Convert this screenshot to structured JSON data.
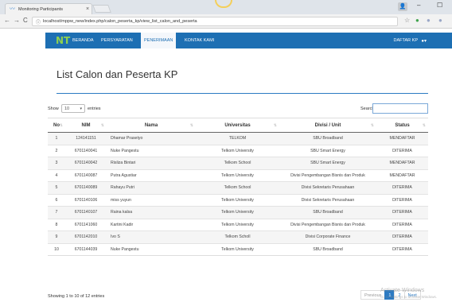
{
  "browser": {
    "tab_title": "Monitoring Participants",
    "tab_close": "×",
    "url": "localhost/mppw_new/index.php/calon_peserta_kp/view_list_calon_and_peserta",
    "back": "←",
    "forward": "→",
    "reload": "C",
    "info": "ⓘ",
    "minimize": "–",
    "maximize": "☐",
    "user_icon": "👤",
    "star": "☆",
    "icons": {
      "back": "arrow-left-icon",
      "forward": "arrow-right-icon",
      "reload": "reload-icon",
      "star": "star-icon"
    }
  },
  "navbar": {
    "brand": "NT",
    "items": [
      "BERANDA",
      "PERSYARATAN",
      "PENERIMAAN",
      "KONTAK KAMI"
    ],
    "active_index": 2,
    "right_label": "DAFTAR KP",
    "user_caret": "▾",
    "colors": {
      "bar": "#1d6fb3",
      "active_bg": "#f4f7fb"
    }
  },
  "page": {
    "title": "List Calon dan Peserta KP"
  },
  "controls": {
    "show_label": "Show",
    "length_value": "10",
    "entries_label": "entries",
    "search_label": "Search:"
  },
  "table": {
    "headers": [
      "No",
      "NIM",
      "Nama",
      "Universitas",
      "Divisi / Unit",
      "Status"
    ],
    "rows": [
      [
        "1",
        "124141151",
        "Dhamar Prasetyo",
        "TELKOM",
        "SBU Broadband",
        "MENDAFTAR"
      ],
      [
        "2",
        "6701140041",
        "Nuke Pangestu",
        "Telkom University",
        "SBU Smart Energy",
        "DITERIMA"
      ],
      [
        "3",
        "6701140042",
        "Risliza Bintari",
        "Telkom School",
        "SBU Smart Energy",
        "MENDAFTAR"
      ],
      [
        "4",
        "6701140087",
        "Putra Agustiar",
        "Telkom University",
        "Divisi Pengembangan Bisnis dan Produk",
        "MENDAFTAR"
      ],
      [
        "5",
        "6701140089",
        "Rahayu Putri",
        "Telkom School",
        "Divisi Sekretaris Perusahaan",
        "DITERIMA"
      ],
      [
        "6",
        "6701140106",
        "miss yuyun",
        "Telkom University",
        "Divisi Sekretaris Perusahaan",
        "DITERIMA"
      ],
      [
        "7",
        "6701140107",
        "Raina kalsa",
        "Telkom University",
        "SBU Broadband",
        "DITERIMA"
      ],
      [
        "8",
        "6701141060",
        "Kartini Kadir",
        "Telkom University",
        "Divisi Pengembangan Bisnis dan Produk",
        "DITERIMA"
      ],
      [
        "9",
        "6701142010",
        "Ivo S",
        "Telkom Scholl",
        "Divisi Corporate Finance",
        "DITERIMA"
      ],
      [
        "10",
        "6701144039",
        "Nuke Pangestu",
        "Telkom University",
        "SBU Broadband",
        "DITERIMA"
      ]
    ]
  },
  "footer": {
    "info": "Showing 1 to 10 of 12 entries",
    "previous": "Previous",
    "pages": [
      "1",
      "2"
    ],
    "next": "Next",
    "current_page": "1"
  },
  "watermark": {
    "line1": "Activate Windows",
    "line2": "Go to Settings to activate Windows."
  }
}
